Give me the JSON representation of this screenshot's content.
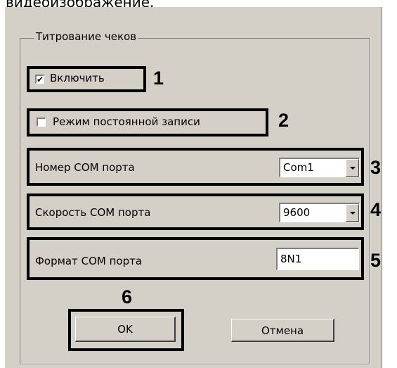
{
  "header_text": "видеоизображение.",
  "group": {
    "title": "Титрование чеков"
  },
  "enable": {
    "label": "Включить",
    "checked": true,
    "marker": "1"
  },
  "constant_record": {
    "label": "Режим постоянной записи",
    "checked": false,
    "marker": "2"
  },
  "com_port_number": {
    "label": "Номер COM порта",
    "value": "Com1",
    "marker": "3"
  },
  "com_port_speed": {
    "label": "Скорость COM порта",
    "value": "9600",
    "marker": "4"
  },
  "com_port_format": {
    "label": "Формат COM порта",
    "value": "8N1",
    "marker": "5"
  },
  "buttons": {
    "ok_label": "OK",
    "cancel_label": "Отмена",
    "ok_marker": "6"
  },
  "icons": {
    "check": "✔",
    "dropdown": "chevron-down-icon"
  }
}
